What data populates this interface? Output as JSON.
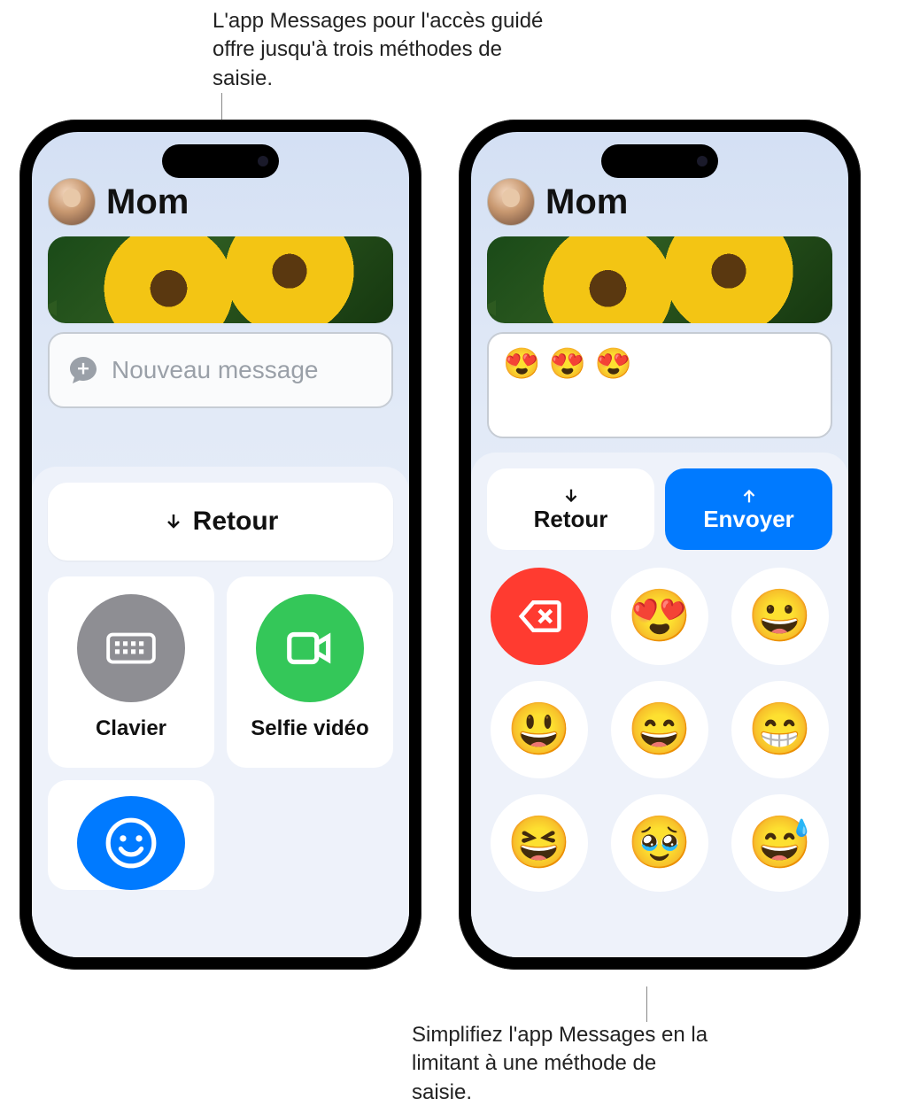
{
  "captions": {
    "top": "L'app Messages pour l'accès guidé offre jusqu'à trois méthodes de saisie.",
    "bottom": "Simplifiez l'app Messages en la limitant à une méthode de saisie."
  },
  "phone_left": {
    "contact": "Mom",
    "input_placeholder": "Nouveau message",
    "return_label": "Retour",
    "options": {
      "keyboard": "Clavier",
      "video": "Selfie vidéo"
    }
  },
  "phone_right": {
    "contact": "Mom",
    "compose_value": "😍 😍 😍",
    "return_label": "Retour",
    "send_label": "Envoyer",
    "emoji_grid": [
      "__delete__",
      "😍",
      "😀",
      "😃",
      "😄",
      "😁",
      "😆",
      "🥹",
      "😅"
    ]
  }
}
